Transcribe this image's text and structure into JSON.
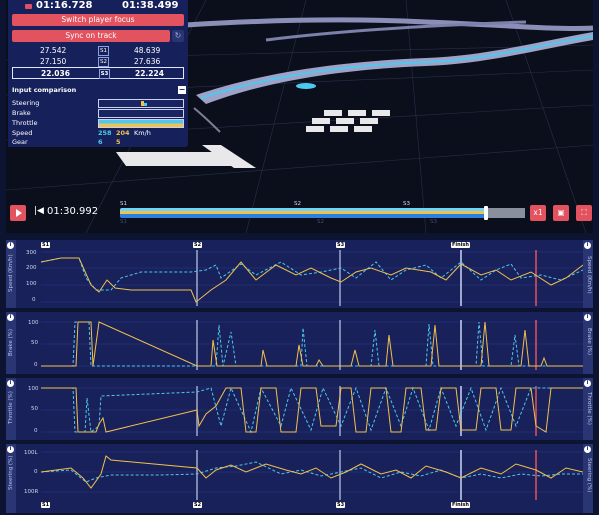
{
  "lap_times": {
    "player1": "01:16.728",
    "player2": "01:38.499"
  },
  "buttons": {
    "switch_focus": "Switch player focus",
    "sync_track": "Sync on track"
  },
  "sectors": [
    {
      "label": "S1",
      "p1": "27.542",
      "p2": "48.639"
    },
    {
      "label": "S2",
      "p1": "27.150",
      "p2": "27.636"
    },
    {
      "label": "S3",
      "p1": "22.036",
      "p2": "22.224"
    }
  ],
  "input_comparison": {
    "title": "Input comparison",
    "labels": [
      "Steering",
      "Brake",
      "Throttle",
      "Speed",
      "Gear"
    ],
    "speed": {
      "p1": "258",
      "p2": "204",
      "unit": "Km/h"
    },
    "gear": {
      "p1": "6",
      "p2": "5"
    }
  },
  "playback": {
    "current_time": "01:30.992",
    "speed": "x1",
    "progress": 0.906
  },
  "timeline_labels": {
    "top": [
      "S1",
      "S2",
      "S3"
    ],
    "bottom": [
      "S1",
      "S2",
      "S3"
    ]
  },
  "colors": {
    "player1": "#4fc8f0",
    "player2": "#f2c14e",
    "accent": "#e2525f"
  },
  "charts": [
    {
      "name": "speed",
      "ylabel": "Speed (Km/h)",
      "ticks": [
        "300",
        "200",
        "100",
        "0"
      ]
    },
    {
      "name": "brake",
      "ylabel": "Brake (%)",
      "ticks": [
        "100",
        "50",
        "0"
      ]
    },
    {
      "name": "throttle",
      "ylabel": "Throttle (%)",
      "ticks": [
        "100",
        "50",
        "0"
      ]
    },
    {
      "name": "steering",
      "ylabel": "Steering (%)",
      "ticks": [
        "100L",
        "0",
        "100R"
      ]
    }
  ],
  "sector_markers": {
    "top": [
      "S1",
      "S2",
      "S3",
      "Finish"
    ],
    "bottom": [
      "S1",
      "S2",
      "S3",
      "Finish"
    ]
  }
}
